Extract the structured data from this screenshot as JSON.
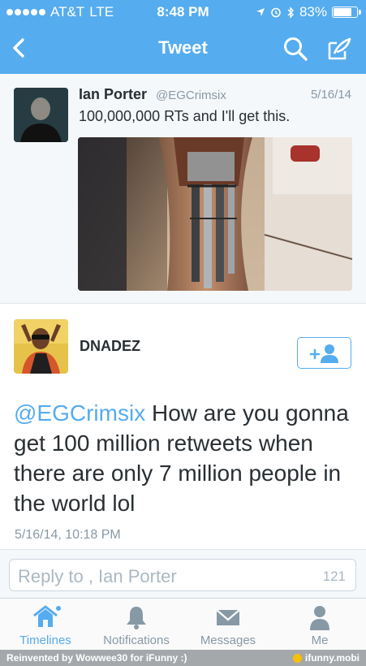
{
  "status_bar": {
    "carrier": "AT&T",
    "network": "LTE",
    "time": "8:48 PM",
    "battery": "83%",
    "battery_level": 0.83,
    "signal_bars": 5
  },
  "nav": {
    "title": "Tweet",
    "back_icon": "back-chevron-icon",
    "search_icon": "search-icon",
    "compose_icon": "compose-icon"
  },
  "tweet": {
    "author_name": "Ian Porter",
    "author_handle": "@EGCrimsix",
    "date": "5/16/14",
    "text": "100,000,000 RTs and I'll get this."
  },
  "reply_tweet": {
    "author_name": "DNADEZ",
    "mention": "@EGCrimsix",
    "text": " How are you gonna get 100 million retweets when there are only 7 million people in the world lol",
    "timestamp": "5/16/14, 10:18 PM"
  },
  "reply_bar": {
    "placeholder": "Reply to , Ian Porter",
    "char_count": "121"
  },
  "tabs": [
    {
      "label": "Timelines",
      "icon": "home-icon",
      "active": true
    },
    {
      "label": "Notifications",
      "icon": "bell-icon",
      "active": false
    },
    {
      "label": "Messages",
      "icon": "envelope-icon",
      "active": false
    },
    {
      "label": "Me",
      "icon": "person-icon",
      "active": false
    }
  ],
  "watermark": {
    "left_text": "Reinvented by Wowwee30 for iFunny :)",
    "right_text": "ifunny.mobi"
  },
  "colors": {
    "brand": "#55acee",
    "text": "#292f33",
    "muted": "#8899a6"
  }
}
